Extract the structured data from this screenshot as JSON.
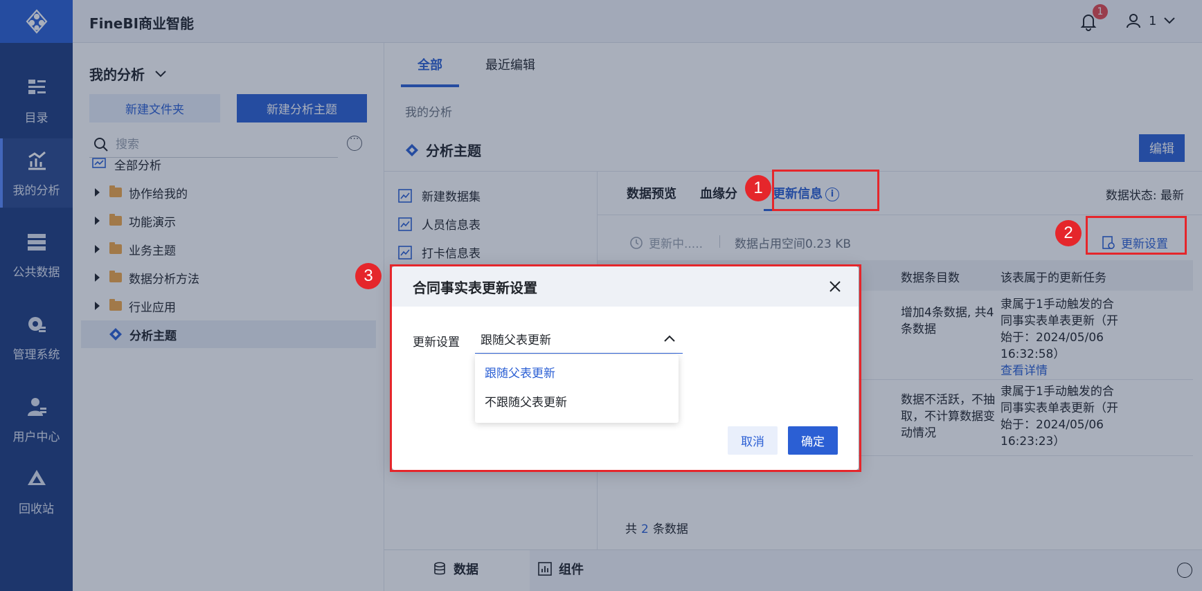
{
  "app": {
    "title": "FineBI商业智能"
  },
  "nav": {
    "items": [
      {
        "label": "目录",
        "icon": "catalog-icon"
      },
      {
        "label": "我的分析",
        "icon": "analysis-icon",
        "active": true
      },
      {
        "label": "公共数据",
        "icon": "public-data-icon"
      },
      {
        "label": "管理系统",
        "icon": "gear-icon"
      },
      {
        "label": "用户中心",
        "icon": "user-center-icon"
      },
      {
        "label": "回收站",
        "icon": "recycle-icon"
      }
    ]
  },
  "header": {
    "notification_count": "1",
    "user": "1"
  },
  "directory": {
    "title": "我的分析",
    "new_folder": "新建文件夹",
    "new_subject": "新建分析主题",
    "search_placeholder": "搜索",
    "tree": [
      {
        "label": "全部分析"
      },
      {
        "label": "协作给我的"
      },
      {
        "label": "功能演示"
      },
      {
        "label": "业务主题"
      },
      {
        "label": "数据分析方法"
      },
      {
        "label": "行业应用"
      },
      {
        "label": "分析主题",
        "selected": true
      }
    ]
  },
  "main": {
    "tabs": [
      {
        "label": "全部",
        "active": true
      },
      {
        "label": "最近编辑"
      }
    ],
    "breadcrumb": "我的分析",
    "subject_title": "分析主题",
    "edit": "编辑",
    "tables": [
      "新建数据集",
      "人员信息表",
      "打卡信息表"
    ],
    "detail_tabs": [
      "数据预览",
      "血缘分",
      "更新信息"
    ],
    "data_status": "数据状态: 最新",
    "updating": "更新中.....",
    "space": "数据占用空间0.23 KB",
    "update_settings": "更新设置",
    "columns": [
      "数据条目数",
      "该表属于的更新任务"
    ],
    "rows": [
      {
        "count": "增加4条数据, 共4条数据",
        "task": "隶属于1手动触发的合同事实表单表更新（开始于：2024/05/06 16:32:58）",
        "link": "查看详情"
      },
      {
        "count": "数据不活跃，不抽取，不计算数据变动情况",
        "task": "隶属于1手动触发的合同事实表单表更新（开始于：2024/05/06 16:23:23）"
      }
    ],
    "total_prefix": "共",
    "total_count": "2",
    "total_suffix": "条数据",
    "bottom_tabs": [
      "数据",
      "组件"
    ]
  },
  "dialog": {
    "title": "合同事实表更新设置",
    "field_label": "更新设置",
    "selected": "跟随父表更新",
    "options": [
      "跟随父表更新",
      "不跟随父表更新"
    ],
    "cancel": "取消",
    "ok": "确定"
  },
  "annotations": [
    "1",
    "2",
    "3"
  ],
  "colors": {
    "primary": "#2b5fd4",
    "nav": "#1e3c80",
    "highlight": "#e5262b"
  }
}
